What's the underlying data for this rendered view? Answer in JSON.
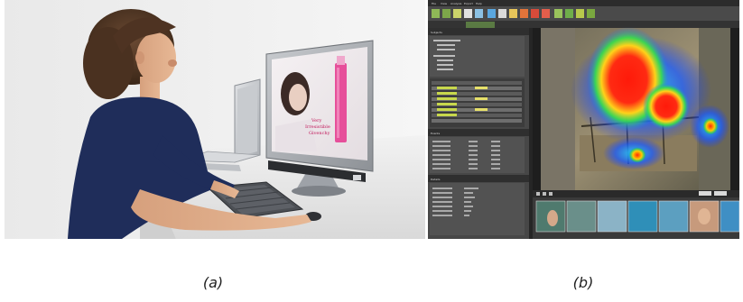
{
  "captions": {
    "a": "(a)",
    "b": "(b)"
  },
  "panel_a": {
    "description_icon": "user-at-eye-tracker-photo",
    "screen_ad": {
      "line1": "Very",
      "line2": "Irresistible",
      "line3": "Givenchy"
    }
  },
  "panel_b": {
    "description_icon": "eye-tracking-heatmap-software",
    "menu": [
      "File",
      "View",
      "Analysis",
      "Export",
      "Help"
    ],
    "side_headers": [
      "Subjects",
      "Events",
      "Details"
    ],
    "accent": "#ff2a1a"
  }
}
